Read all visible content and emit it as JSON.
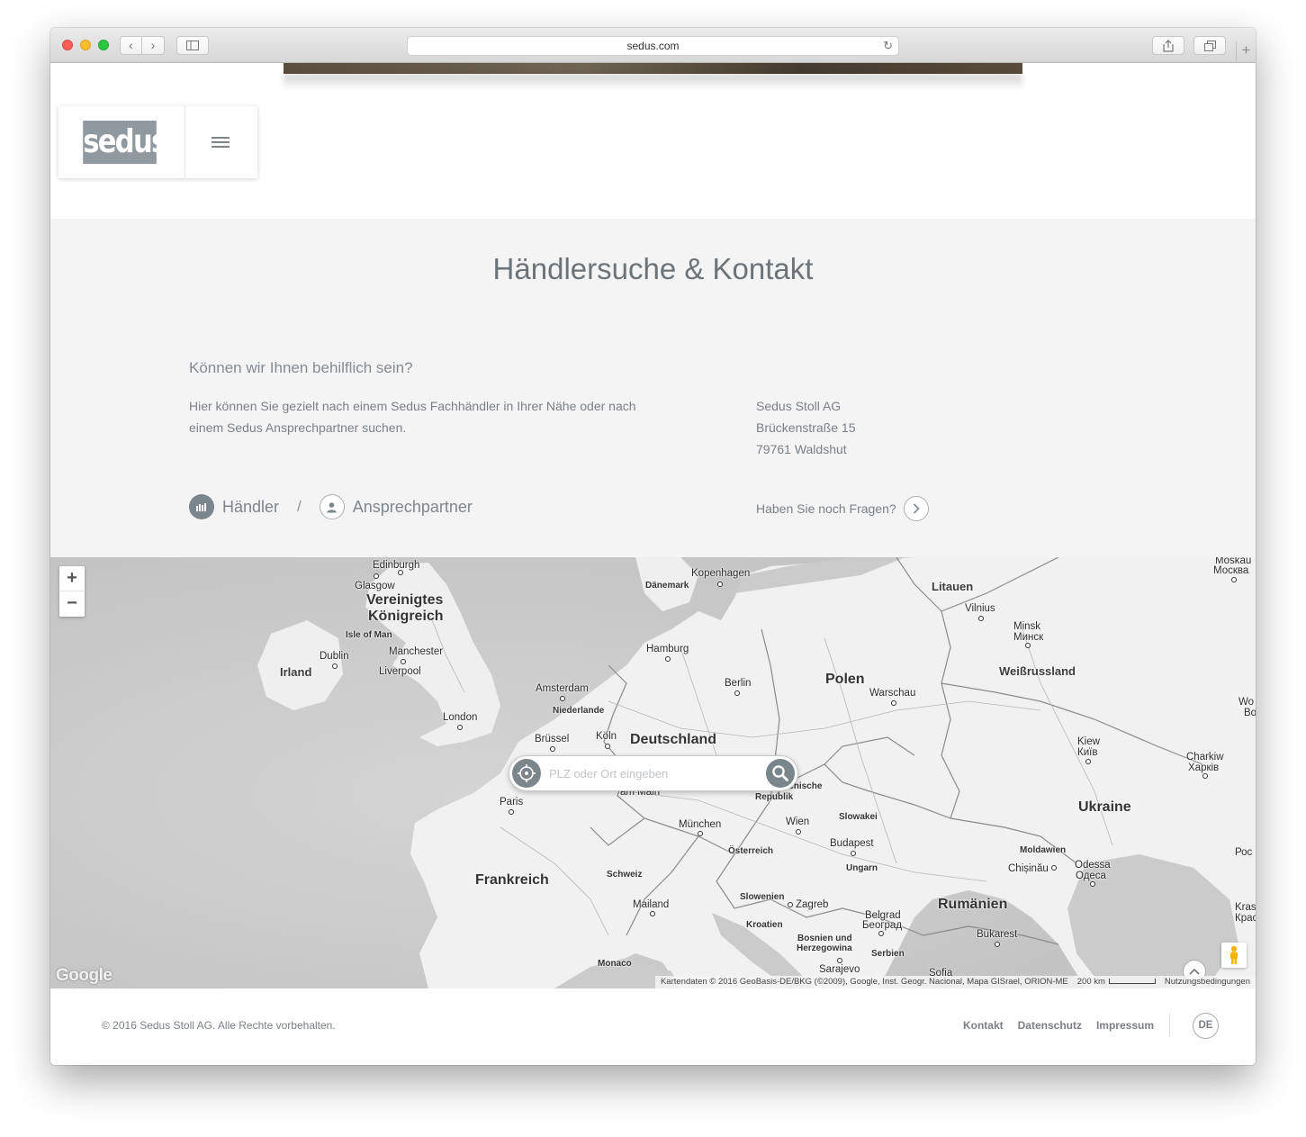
{
  "browser": {
    "url": "sedus.com"
  },
  "brand": {
    "logo_text": "sedus",
    "logo_color": "#9199a0"
  },
  "header": {
    "menu_icon": "hamburger-icon"
  },
  "contact": {
    "title": "Händlersuche & Kontakt",
    "question": "Können wir Ihnen behilflich sein?",
    "intro_line1": "Hier können Sie gezielt nach einem Sedus Fachhändler in Ihrer Nähe oder nach",
    "intro_line2": "einem Sedus Ansprechpartner suchen.",
    "address": {
      "company": "Sedus Stoll AG",
      "street": "Brückenstraße 15",
      "city": "79761 Waldshut"
    },
    "tabs": [
      {
        "label": "Händler",
        "icon": "building-icon",
        "active": true
      },
      {
        "label": "Ansprechpartner",
        "icon": "person-icon",
        "active": false
      }
    ],
    "tab_separator": "/",
    "faq_label": "Haben Sie noch Fragen?"
  },
  "map": {
    "zoom_in": "+",
    "zoom_out": "−",
    "search_placeholder": "PLZ oder Ort eingeben",
    "google_label": "Google",
    "attribution": "Kartendaten © 2016 GeoBasis-DE/BKG (©2009), Google, Inst. Geogr. Nacional, Mapa GISrael, ORION-ME",
    "scale": "200 km",
    "terms": "Nutzungsbedingungen",
    "labels": {
      "edinburgh": "Edinburgh",
      "glasgow": "Glasgow",
      "uk1": "Vereinigtes",
      "uk2": "Königreich",
      "isle_of_man": "Isle of Man",
      "dublin": "Dublin",
      "ireland": "Irland",
      "manchester": "Manchester",
      "liverpool": "Liverpool",
      "london": "London",
      "kopenhagen": "Kopenhagen",
      "daenemark": "Dänemark",
      "hamburg": "Hamburg",
      "amsterdam": "Amsterdam",
      "niederlande": "Niederlande",
      "bruessel": "Brüssel",
      "koeln": "Köln",
      "deutschland": "Deutschland",
      "berlin": "Berlin",
      "polen": "Polen",
      "warschau": "Warschau",
      "litauen": "Litauen",
      "vilnius": "Vilnius",
      "minsk": "Minsk",
      "minsk_ru": "Минск",
      "weissrussland": "Weißrussland",
      "moskau": "Moskau",
      "moskau_ru": "Москва",
      "kiew": "Kiew",
      "kiew_ua": "Київ",
      "charkiw": "Charkiw",
      "charkiw_ua": "Харків",
      "ukraine": "Ukraine",
      "wo": "Wo",
      "bo": "Bo",
      "tschech1": "Tschechische",
      "tschech2": "Republik",
      "am_main": "am Main",
      "paris": "Paris",
      "muenchen": "München",
      "wien": "Wien",
      "slowakei": "Slowakei",
      "budapest": "Budapest",
      "ungarn": "Ungarn",
      "oesterreich": "Österreich",
      "moldawien": "Moldawien",
      "chisinau": "Chișinău",
      "odessa": "Odessa",
      "odessa_ua": "Одеса",
      "ros": "Рос",
      "frankreich": "Frankreich",
      "schweiz": "Schweiz",
      "mailand": "Mailand",
      "slowenien": "Slowenien",
      "zagreb": "Zagreb",
      "kroatien": "Kroatien",
      "belgrad": "Belgrad",
      "belgrad_rs": "Београд",
      "rumaenien": "Rumänien",
      "bukarest": "Bukarest",
      "bosnien1": "Bosnien und",
      "bosnien2": "Herzegowina",
      "serbien": "Serbien",
      "sarajevo": "Sarajevo",
      "sofia": "Sofia",
      "monaco": "Monaco",
      "kras": "Kras",
      "kras2": "Крас"
    }
  },
  "footer": {
    "copyright": "© 2016 Sedus Stoll AG. Alle Rechte vorbehalten.",
    "links": [
      "Kontakt",
      "Datenschutz",
      "Impressum"
    ],
    "language": "DE"
  }
}
